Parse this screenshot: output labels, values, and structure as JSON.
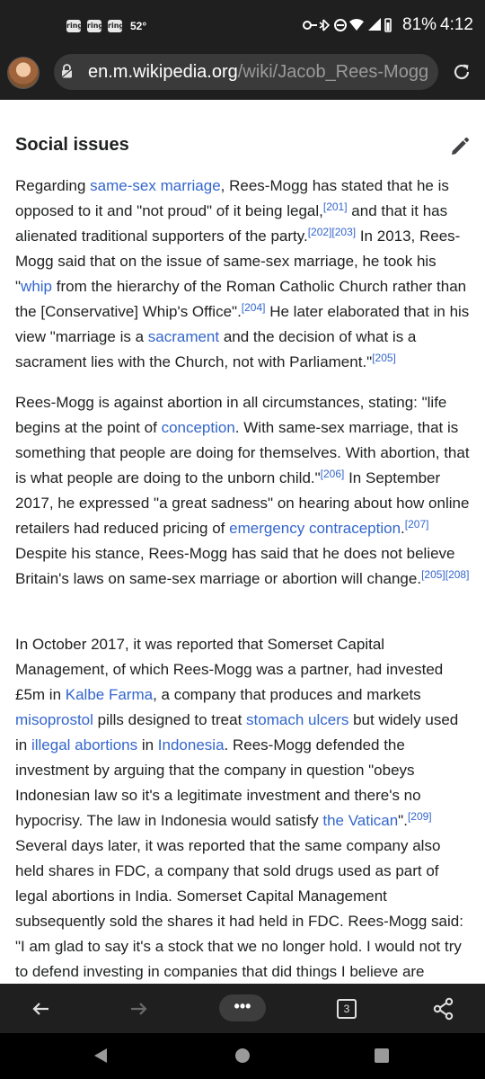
{
  "status_bar": {
    "notif1": "ring",
    "notif2": "ring",
    "notif3": "ring",
    "temperature": "52°",
    "battery": "81%",
    "time": "4:12"
  },
  "browser": {
    "url_domain": "en.m.wikipedia.org",
    "url_path": "/wiki/Jacob_Rees-Mogg"
  },
  "article": {
    "section_heading": "Social issues",
    "p1": [
      {
        "t": "Regarding "
      },
      {
        "t": "same-sex marriage",
        "link": true
      },
      {
        "t": ", Rees-Mogg has stated that he is opposed to it and \"not proud\" of it being legal,"
      },
      {
        "t": "[201]",
        "ref": true
      },
      {
        "t": " and that it has alienated traditional supporters of the party."
      },
      {
        "t": "[202][203]",
        "ref": true
      },
      {
        "t": " In 2013, Rees-Mogg said that on the issue of same-sex marriage, he took his \""
      },
      {
        "t": "whip",
        "link": true
      },
      {
        "t": " from the hierarchy of the Roman Catholic Church rather than the [Conservative] Whip's Office\"."
      },
      {
        "t": "[204]",
        "ref": true
      },
      {
        "t": " He later elaborated that in his view \"marriage is a "
      },
      {
        "t": "sacrament",
        "link": true
      },
      {
        "t": " and the decision of what is a sacrament lies with the Church, not with Parliament.\""
      },
      {
        "t": "[205]",
        "ref": true
      }
    ],
    "p2": [
      {
        "t": "Rees-Mogg is against abortion in all circumstances, stating: \"life begins at the point of "
      },
      {
        "t": "conception",
        "link": true
      },
      {
        "t": ". With same-sex marriage, that is something that people are doing for themselves. With abortion, that is what people are doing to the unborn child.\""
      },
      {
        "t": "[206]",
        "ref": true
      },
      {
        "t": " In September 2017, he expressed \"a great sadness\" on hearing about how online retailers had reduced pricing of "
      },
      {
        "t": "emergency contraception",
        "link": true
      },
      {
        "t": "."
      },
      {
        "t": "[207]",
        "ref": true
      },
      {
        "t": " Despite his stance, Rees-Mogg has said that he does not believe Britain's laws on same-sex marriage or abortion will change."
      },
      {
        "t": "[205][208]",
        "ref": true
      }
    ],
    "p3": [
      {
        "t": "In October 2017, it was reported that Somerset Capital Management, of which Rees-Mogg was a partner, had invested £5m in "
      },
      {
        "t": "Kalbe Farma",
        "link": true
      },
      {
        "t": ", a company that produces and markets "
      },
      {
        "t": "misoprostol",
        "link": true
      },
      {
        "t": " pills designed to treat "
      },
      {
        "t": "stomach ulcers",
        "link": true
      },
      {
        "t": " but widely used in "
      },
      {
        "t": "illegal abortions",
        "link": true
      },
      {
        "t": " in "
      },
      {
        "t": "Indonesia",
        "link": true
      },
      {
        "t": ". Rees-Mogg defended the investment by arguing that the company in question \"obeys Indonesian law so it's a legitimate investment and there's no hypocrisy. The law in Indonesia would satisfy "
      },
      {
        "t": "the Vatican",
        "link": true
      },
      {
        "t": "\"."
      },
      {
        "t": "[209]",
        "ref": true
      },
      {
        "t": " Several days later, it was reported that the same company also held shares in FDC, a company that sold drugs used as part of legal abortions in India. Somerset Capital Management subsequently sold the shares it had held in FDC. Rees-Mogg said: \"I am glad to say it's a stock that we no longer hold. I would not try to defend investing in companies that did things I believe are morally"
      }
    ]
  },
  "toolbar": {
    "menu_label": "•••",
    "tab_count": "3"
  },
  "colors": {
    "link": "#3366cc",
    "chrome_bg": "#1f1f1f"
  }
}
